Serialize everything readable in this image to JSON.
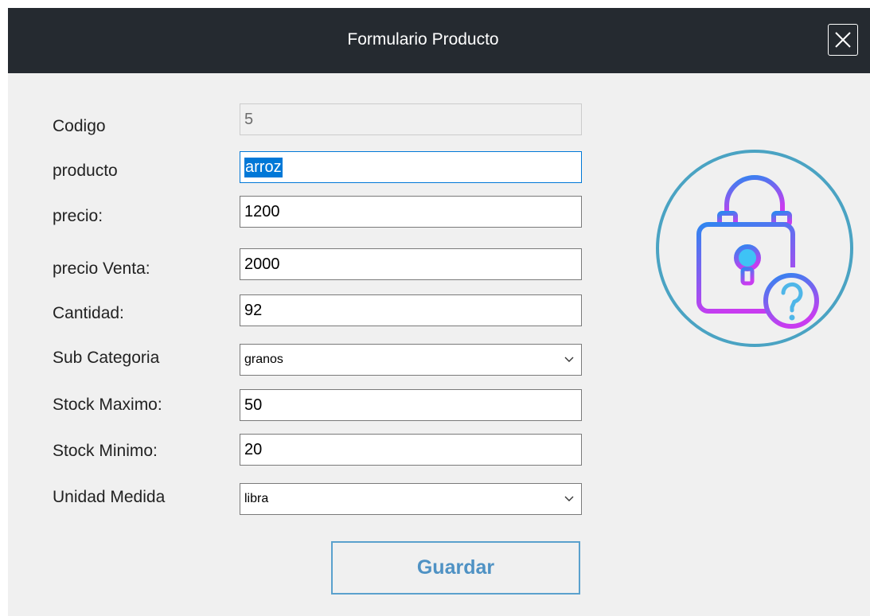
{
  "window": {
    "title": "Formulario Producto",
    "icons": {
      "close": "close-icon",
      "illustration": "padlock-question-icon"
    }
  },
  "form": {
    "codigo": {
      "label": "Codigo",
      "value": "5"
    },
    "producto": {
      "label": "producto",
      "value": "arroz"
    },
    "precio": {
      "label": "precio:",
      "value": "1200"
    },
    "precio_venta": {
      "label": "precio Venta:",
      "value": "2000"
    },
    "cantidad": {
      "label": "Cantidad:",
      "value": "92"
    },
    "sub_categoria": {
      "label": "Sub Categoria",
      "value": "granos"
    },
    "stock_maximo": {
      "label": "Stock Maximo:",
      "value": "50"
    },
    "stock_minimo": {
      "label": "Stock Minimo:",
      "value": "20"
    },
    "unidad_medida": {
      "label": "Unidad Medida",
      "value": "libra"
    }
  },
  "actions": {
    "guardar": "Guardar"
  },
  "colors": {
    "titlebar": "#252a30",
    "accent": "#0078d7",
    "button_border": "#5aa1cd",
    "button_text": "#4f92c4",
    "icon_circle": "#4aa3c3",
    "icon_gradient_start": "#2f86f0",
    "icon_gradient_end": "#c83cf0"
  }
}
